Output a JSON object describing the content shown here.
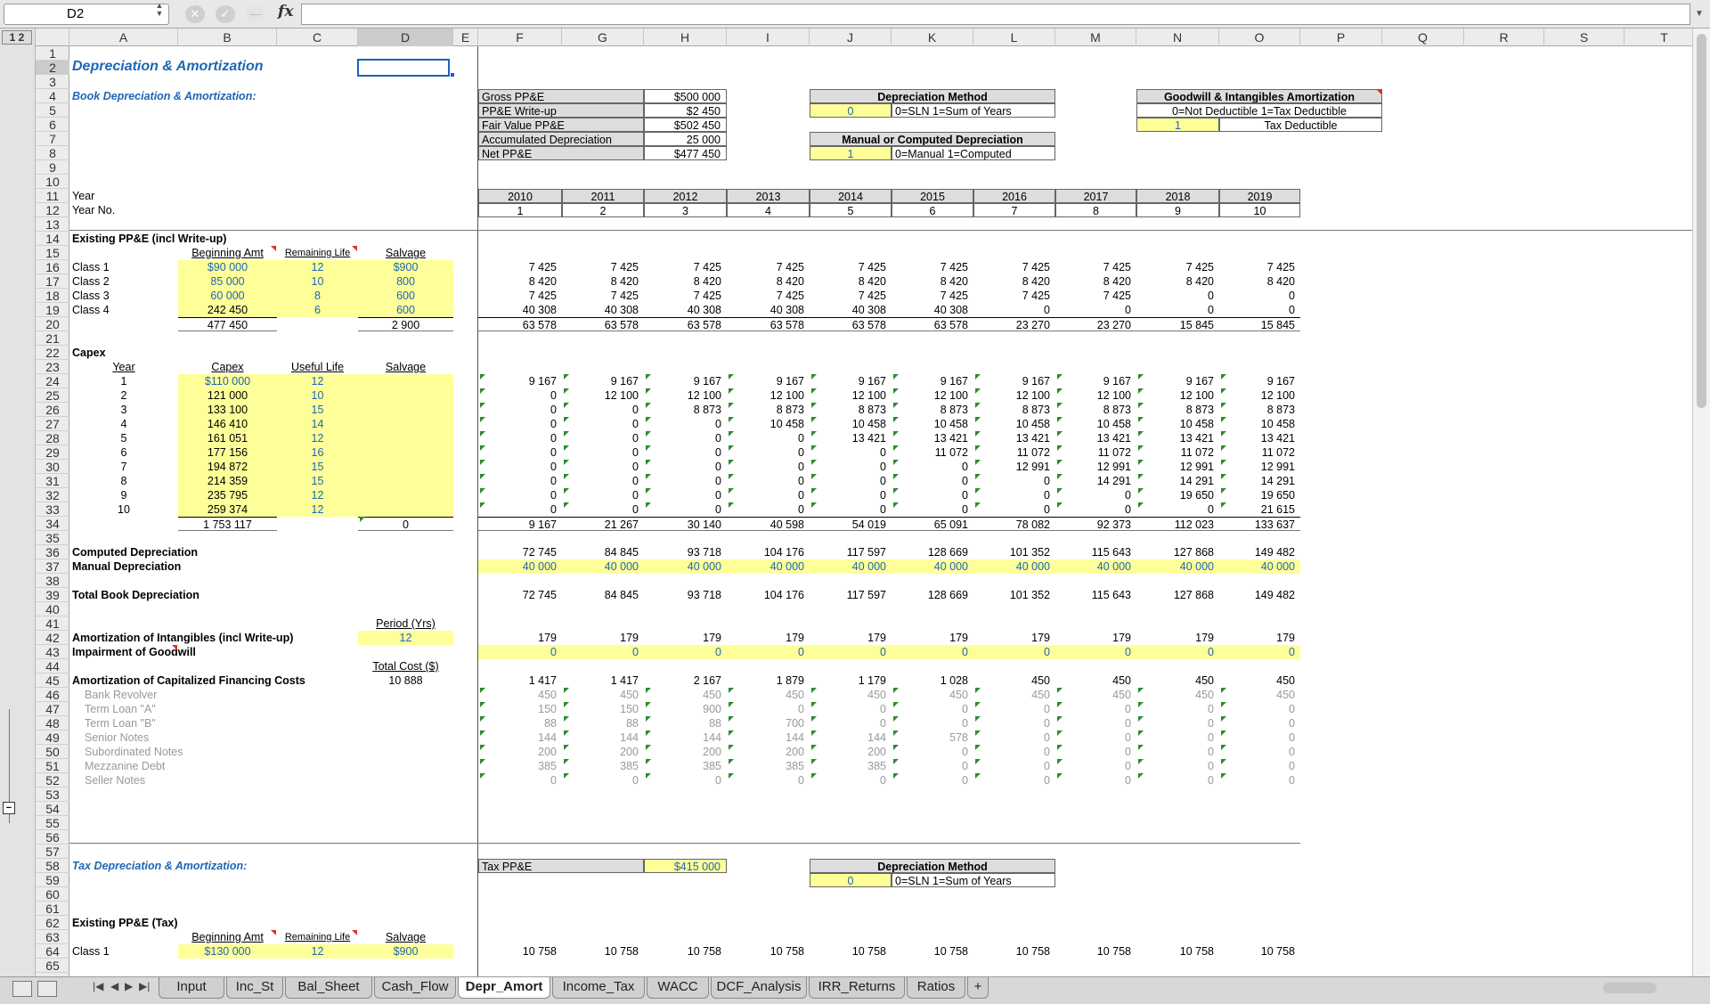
{
  "formula_bar": {
    "cell_ref": "D2",
    "fx": "fx",
    "formula": ""
  },
  "columns": [
    "A",
    "B",
    "C",
    "D",
    "E",
    "F",
    "G",
    "H",
    "I",
    "J",
    "K",
    "L",
    "M",
    "N",
    "O",
    "P",
    "Q",
    "R",
    "S",
    "T"
  ],
  "outline_levels": "1 2",
  "rows": [
    "1",
    "2",
    "3",
    "4",
    "5",
    "6",
    "7",
    "8",
    "9",
    "10",
    "11",
    "12",
    "13",
    "14",
    "15",
    "16",
    "17",
    "18",
    "19",
    "20",
    "21",
    "22",
    "23",
    "24",
    "25",
    "26",
    "27",
    "28",
    "29",
    "30",
    "31",
    "32",
    "33",
    "34",
    "35",
    "36",
    "37",
    "38",
    "39",
    "40",
    "41",
    "42",
    "43",
    "44",
    "45",
    "46",
    "47",
    "48",
    "49",
    "50",
    "51",
    "52",
    "53",
    "54",
    "55",
    "56",
    "57",
    "58",
    "59",
    "60",
    "61",
    "62",
    "63",
    "64",
    "65"
  ],
  "sheet": {
    "title": "Depreciation & Amortization",
    "book_title": "Book Depreciation & Amortization:",
    "ppe_box": [
      {
        "label": "Gross PP&E",
        "value": "$500 000"
      },
      {
        "label": "PP&E Write-up",
        "value": "$2 450"
      },
      {
        "label": "Fair Value PP&E",
        "value": "$502 450"
      },
      {
        "label": "Accumulated Depreciation",
        "value": "25 000"
      },
      {
        "label": "Net PP&E",
        "value": "$477 450"
      }
    ],
    "dep_method": {
      "title": "Depreciation Method",
      "value": "0",
      "desc": "0=SLN   1=Sum of Years"
    },
    "manual_comp": {
      "title": "Manual or Computed Depreciation",
      "value": "1",
      "desc": "0=Manual   1=Computed"
    },
    "goodwill": {
      "title": "Goodwill & Intangibles Amortization",
      "desc": "0=Not Deductible   1=Tax Deductible",
      "value": "1",
      "value_label": "Tax Deductible"
    },
    "year_label": "Year",
    "yearno_label": "Year No.",
    "years": [
      "2010",
      "2011",
      "2012",
      "2013",
      "2014",
      "2015",
      "2016",
      "2017",
      "2018",
      "2019"
    ],
    "year_nos": [
      "1",
      "2",
      "3",
      "4",
      "5",
      "6",
      "7",
      "8",
      "9",
      "10"
    ],
    "existing": {
      "title": "Existing PP&E (incl Write-up)",
      "headers": [
        "Beginning Amt",
        "Remaining Life",
        "Salvage"
      ],
      "rows": [
        {
          "label": "Class 1",
          "amt": "$90 000",
          "life": "12",
          "salvage": "$900",
          "values": [
            "7 425",
            "7 425",
            "7 425",
            "7 425",
            "7 425",
            "7 425",
            "7 425",
            "7 425",
            "7 425",
            "7 425"
          ]
        },
        {
          "label": "Class 2",
          "amt": "85 000",
          "life": "10",
          "salvage": "800",
          "values": [
            "8 420",
            "8 420",
            "8 420",
            "8 420",
            "8 420",
            "8 420",
            "8 420",
            "8 420",
            "8 420",
            "8 420"
          ]
        },
        {
          "label": "Class 3",
          "amt": "60 000",
          "life": "8",
          "salvage": "600",
          "values": [
            "7 425",
            "7 425",
            "7 425",
            "7 425",
            "7 425",
            "7 425",
            "7 425",
            "7 425",
            "0",
            "0"
          ]
        },
        {
          "label": "Class 4",
          "amt": "242 450",
          "life": "6",
          "salvage": "600",
          "values": [
            "40 308",
            "40 308",
            "40 308",
            "40 308",
            "40 308",
            "40 308",
            "0",
            "0",
            "0",
            "0"
          ]
        }
      ],
      "total_amt": "477 450",
      "total_salvage": "2 900",
      "totals": [
        "63 578",
        "63 578",
        "63 578",
        "63 578",
        "63 578",
        "63 578",
        "23 270",
        "23 270",
        "15 845",
        "15 845"
      ]
    },
    "capex": {
      "title": "Capex",
      "headers": [
        "Year",
        "Capex",
        "Useful Life",
        "Salvage"
      ],
      "rows": [
        {
          "year": "1",
          "capex": "$110 000",
          "life": "12",
          "values": [
            "9 167",
            "9 167",
            "9 167",
            "9 167",
            "9 167",
            "9 167",
            "9 167",
            "9 167",
            "9 167",
            "9 167"
          ]
        },
        {
          "year": "2",
          "capex": "121 000",
          "life": "10",
          "values": [
            "0",
            "12 100",
            "12 100",
            "12 100",
            "12 100",
            "12 100",
            "12 100",
            "12 100",
            "12 100",
            "12 100"
          ]
        },
        {
          "year": "3",
          "capex": "133 100",
          "life": "15",
          "values": [
            "0",
            "0",
            "8 873",
            "8 873",
            "8 873",
            "8 873",
            "8 873",
            "8 873",
            "8 873",
            "8 873"
          ]
        },
        {
          "year": "4",
          "capex": "146 410",
          "life": "14",
          "values": [
            "0",
            "0",
            "0",
            "10 458",
            "10 458",
            "10 458",
            "10 458",
            "10 458",
            "10 458",
            "10 458"
          ]
        },
        {
          "year": "5",
          "capex": "161 051",
          "life": "12",
          "values": [
            "0",
            "0",
            "0",
            "0",
            "13 421",
            "13 421",
            "13 421",
            "13 421",
            "13 421",
            "13 421"
          ]
        },
        {
          "year": "6",
          "capex": "177 156",
          "life": "16",
          "values": [
            "0",
            "0",
            "0",
            "0",
            "0",
            "11 072",
            "11 072",
            "11 072",
            "11 072",
            "11 072"
          ]
        },
        {
          "year": "7",
          "capex": "194 872",
          "life": "15",
          "values": [
            "0",
            "0",
            "0",
            "0",
            "0",
            "0",
            "12 991",
            "12 991",
            "12 991",
            "12 991"
          ]
        },
        {
          "year": "8",
          "capex": "214 359",
          "life": "15",
          "values": [
            "0",
            "0",
            "0",
            "0",
            "0",
            "0",
            "0",
            "14 291",
            "14 291",
            "14 291"
          ]
        },
        {
          "year": "9",
          "capex": "235 795",
          "life": "12",
          "values": [
            "0",
            "0",
            "0",
            "0",
            "0",
            "0",
            "0",
            "0",
            "19 650",
            "19 650"
          ]
        },
        {
          "year": "10",
          "capex": "259 374",
          "life": "12",
          "values": [
            "0",
            "0",
            "0",
            "0",
            "0",
            "0",
            "0",
            "0",
            "0",
            "21 615"
          ]
        }
      ],
      "total_capex": "1 753 117",
      "total_salvage": "0",
      "totals": [
        "9 167",
        "21 267",
        "30 140",
        "40 598",
        "54 019",
        "65 091",
        "78 082",
        "92 373",
        "112 023",
        "133 637"
      ]
    },
    "computed_dep": {
      "label": "Computed Depreciation",
      "values": [
        "72 745",
        "84 845",
        "93 718",
        "104 176",
        "117 597",
        "128 669",
        "101 352",
        "115 643",
        "127 868",
        "149 482"
      ]
    },
    "manual_dep": {
      "label": "Manual Depreciation",
      "values": [
        "40 000",
        "40 000",
        "40 000",
        "40 000",
        "40 000",
        "40 000",
        "40 000",
        "40 000",
        "40 000",
        "40 000"
      ]
    },
    "total_book": {
      "label": "Total Book Depreciation",
      "values": [
        "72 745",
        "84 845",
        "93 718",
        "104 176",
        "117 597",
        "128 669",
        "101 352",
        "115 643",
        "127 868",
        "149 482"
      ]
    },
    "period_label": "Period (Yrs)",
    "amort_intang": {
      "label": "Amortization of Intangibles (incl Write-up)",
      "period": "12",
      "values": [
        "179",
        "179",
        "179",
        "179",
        "179",
        "179",
        "179",
        "179",
        "179",
        "179"
      ]
    },
    "impairment": {
      "label": "Impairment of Goodwill",
      "values": [
        "0",
        "0",
        "0",
        "0",
        "0",
        "0",
        "0",
        "0",
        "0",
        "0"
      ]
    },
    "total_cost_label": "Total Cost ($)",
    "amort_fin": {
      "label": "Amortization of Capitalized Financing Costs",
      "total_cost": "10 888",
      "values": [
        "1 417",
        "1 417",
        "2 167",
        "1 879",
        "1 179",
        "1 028",
        "450",
        "450",
        "450",
        "450"
      ]
    },
    "fin_rows": [
      {
        "label": "Bank Revolver",
        "values": [
          "450",
          "450",
          "450",
          "450",
          "450",
          "450",
          "450",
          "450",
          "450",
          "450"
        ]
      },
      {
        "label": "Term Loan \"A\"",
        "values": [
          "150",
          "150",
          "900",
          "0",
          "0",
          "0",
          "0",
          "0",
          "0",
          "0"
        ]
      },
      {
        "label": "Term Loan \"B\"",
        "values": [
          "88",
          "88",
          "88",
          "700",
          "0",
          "0",
          "0",
          "0",
          "0",
          "0"
        ]
      },
      {
        "label": "Senior Notes",
        "values": [
          "144",
          "144",
          "144",
          "144",
          "144",
          "578",
          "0",
          "0",
          "0",
          "0"
        ]
      },
      {
        "label": "Subordinated Notes",
        "values": [
          "200",
          "200",
          "200",
          "200",
          "200",
          "0",
          "0",
          "0",
          "0",
          "0"
        ]
      },
      {
        "label": "Mezzanine Debt",
        "values": [
          "385",
          "385",
          "385",
          "385",
          "385",
          "0",
          "0",
          "0",
          "0",
          "0"
        ]
      },
      {
        "label": "Seller Notes",
        "values": [
          "0",
          "0",
          "0",
          "0",
          "0",
          "0",
          "0",
          "0",
          "0",
          "0"
        ]
      }
    ],
    "tax_title": "Tax Depreciation & Amortization:",
    "tax_ppe": {
      "label": "Tax PP&E",
      "value": "$415 000"
    },
    "tax_dep_method": {
      "title": "Depreciation Method",
      "value": "0",
      "desc": "0=SLN   1=Sum of Years"
    },
    "existing_tax": {
      "title": "Existing PP&E (Tax)",
      "headers": [
        "Beginning Amt",
        "Remaining Life",
        "Salvage"
      ],
      "class1": {
        "label": "Class 1",
        "amt": "$130 000",
        "life": "12",
        "salvage": "$900",
        "values": [
          "10 758",
          "10 758",
          "10 758",
          "10 758",
          "10 758",
          "10 758",
          "10 758",
          "10 758",
          "10 758",
          "10 758"
        ]
      }
    }
  },
  "tabs": [
    "Input",
    "Inc_St",
    "Bal_Sheet",
    "Cash_Flow",
    "Depr_Amort",
    "Income_Tax",
    "WACC",
    "DCF_Analysis",
    "IRR_Returns",
    "Ratios",
    "+"
  ],
  "active_tab": "Depr_Amort",
  "colors": {
    "accent_blue": "#1e66b4",
    "input_yellow": "#ffff99",
    "box_gray": "#dddddd",
    "selection": "#1f5fbf"
  }
}
